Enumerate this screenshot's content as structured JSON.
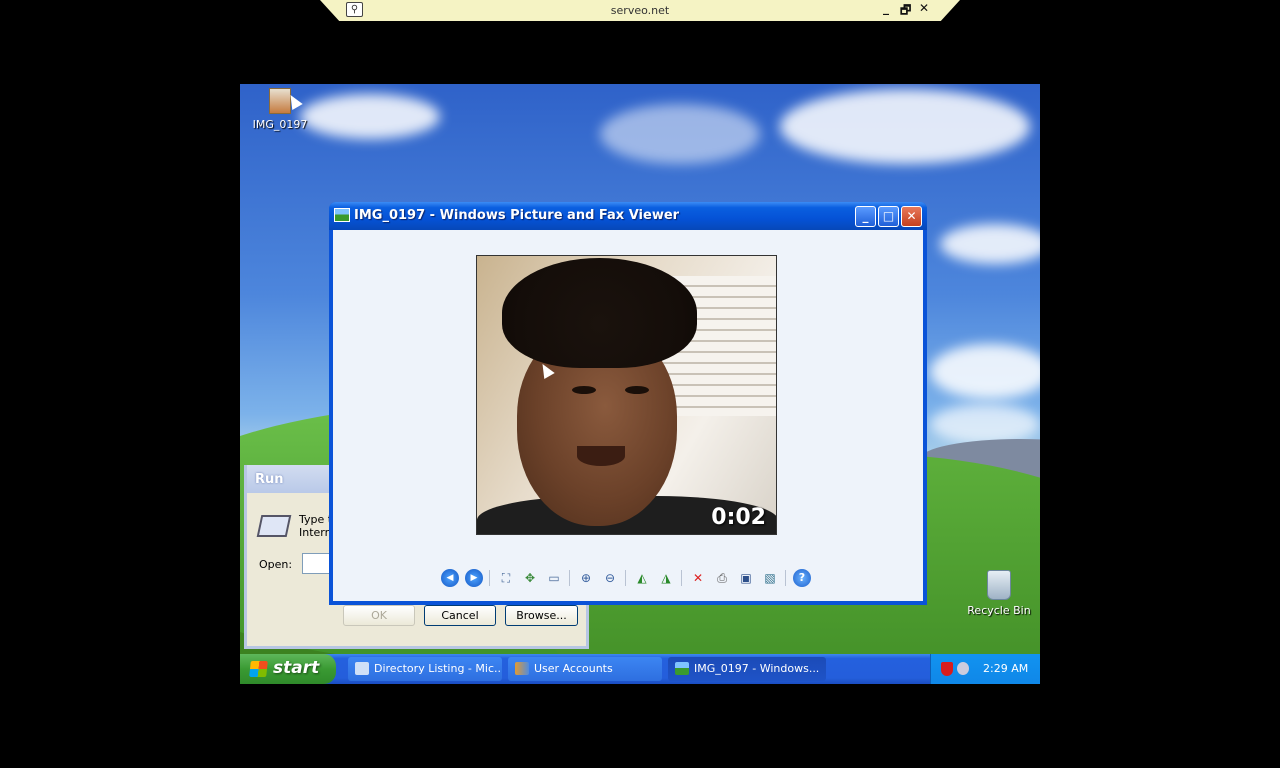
{
  "vnc": {
    "host": "serveo.net",
    "controls": [
      "_",
      "🗗",
      "✕"
    ]
  },
  "desktop": {
    "icons": {
      "img": "IMG_0197",
      "recycle": "Recycle Bin"
    }
  },
  "run_dialog": {
    "title": "Run",
    "desc_line1": "Type t",
    "desc_line2": "Intern",
    "open_label": "Open:",
    "open_value": "",
    "buttons": {
      "ok": "OK",
      "cancel": "Cancel",
      "browse": "Browse..."
    }
  },
  "viewer": {
    "title": "IMG_0197 - Windows Picture and Fax Viewer",
    "photo_timestamp": "0:02",
    "toolbar": [
      "previous-image-icon",
      "next-image-icon",
      "best-fit-icon",
      "actual-size-icon",
      "slideshow-icon",
      "zoom-in-icon",
      "zoom-out-icon",
      "rotate-clockwise-icon",
      "rotate-counterclockwise-icon",
      "delete-icon",
      "print-icon",
      "copy-to-icon",
      "edit-icon",
      "help-icon"
    ]
  },
  "taskbar": {
    "start_label": "start",
    "tasks": [
      {
        "label": "Directory Listing - Mic..."
      },
      {
        "label": "User Accounts"
      },
      {
        "label": "IMG_0197 - Windows..."
      }
    ],
    "clock": "2:29 AM"
  }
}
